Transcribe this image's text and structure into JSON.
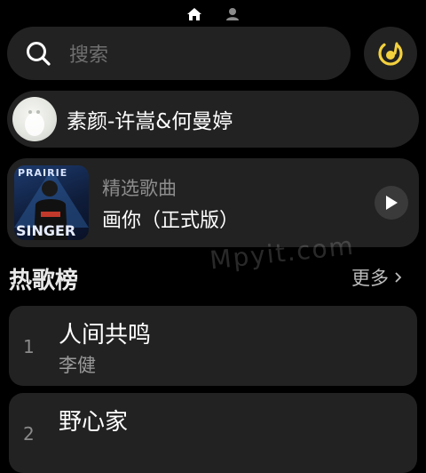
{
  "top_indicator": {
    "icons": [
      "home-icon",
      "person-icon"
    ],
    "colors": {
      "active": "#ffffff",
      "inactive": "#8a8a8a"
    }
  },
  "search": {
    "placeholder": "搜索",
    "icon": "search-icon"
  },
  "player_shortcut": {
    "icon": "vinyl-disc-icon",
    "color": "#f3d03e"
  },
  "now_playing": {
    "title": "素颜-许嵩&何曼婷"
  },
  "featured": {
    "label": "精选歌曲",
    "title": "画你（正式版）",
    "cover_text_top": "PRAIRIE",
    "cover_text_bottom": "SINGER",
    "play_icon": "play-icon"
  },
  "watermark": "Mpyit.com",
  "hot_chart": {
    "title": "热歌榜",
    "more_label": "更多",
    "songs": [
      {
        "rank": "1",
        "title": "人间共鸣",
        "artist": "李健"
      },
      {
        "rank": "2",
        "title": "野心家",
        "artist": ""
      }
    ]
  },
  "theme": {
    "background": "#000000",
    "card": "#222222",
    "accent": "#f3d03e"
  }
}
